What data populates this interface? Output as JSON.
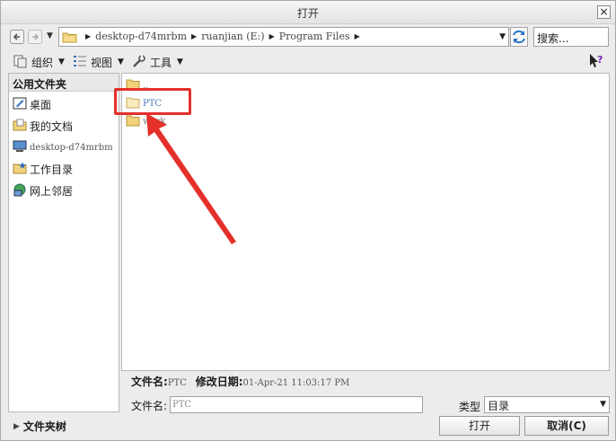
{
  "window": {
    "title": "打开",
    "close_glyph": "×"
  },
  "nav": {
    "breadcrumbs": [
      "desktop-d74mrbm",
      "ruanjian (E:)",
      "Program Files"
    ],
    "search_placeholder": "搜索..."
  },
  "toolbar": {
    "organize": "组织",
    "view": "视图",
    "tools": "工具"
  },
  "sidebar": {
    "header": "公用文件夹",
    "items": [
      {
        "label": "桌面",
        "icon": "desktop-icon"
      },
      {
        "label": "我的文档",
        "icon": "documents-icon"
      },
      {
        "label": "desktop-d74mrbm",
        "icon": "computer-icon"
      },
      {
        "label": "工作目录",
        "icon": "working-directory-icon"
      },
      {
        "label": "网上邻居",
        "icon": "network-icon"
      }
    ]
  },
  "files": [
    {
      "name": "..",
      "icon": "folder-icon"
    },
    {
      "name": "PTC",
      "icon": "folder-icon",
      "selected": true
    },
    {
      "name": "work",
      "icon": "folder-icon"
    }
  ],
  "info": {
    "name_label": "文件名:",
    "name_value": "PTC",
    "date_label": "修改日期:",
    "date_value": "01-Apr-21 11:03:17 PM"
  },
  "filename_row": {
    "label": "文件名:",
    "value": "PTC"
  },
  "type_row": {
    "label": "类型",
    "value": "目录"
  },
  "bottom": {
    "folder_tree": "文件夹树",
    "open": "打开",
    "cancel": "取消(C)"
  },
  "colors": {
    "annotation_red": "#e5302b",
    "folder_yellow": "#f2d27a"
  }
}
